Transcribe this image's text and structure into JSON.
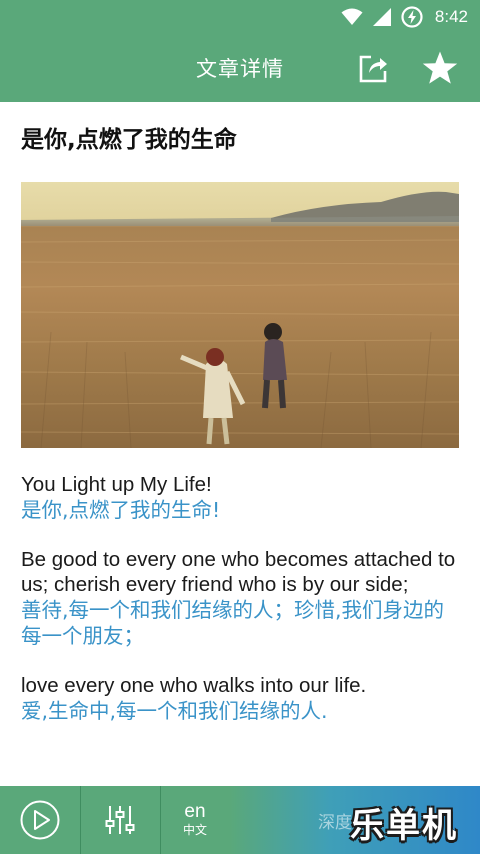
{
  "status_bar": {
    "time": "8:42",
    "icons": [
      "wifi-icon",
      "signal-icon",
      "battery-charging-icon"
    ]
  },
  "app_bar": {
    "title": "文章详情",
    "actions": [
      "share-icon",
      "star-icon"
    ]
  },
  "article": {
    "title": "是你,点燃了我的生命",
    "image": "two people walking in a wheat field",
    "paragraphs": [
      {
        "en": "You Light up My Life!",
        "zh": "是你,点燃了我的生命!"
      },
      {
        "en": "Be good to every one who becomes attached to us; cherish every friend who is by our side;",
        "zh": "善待,每一个和我们结缘的人；珍惜,我们身边的每一个朋友；"
      },
      {
        "en": "love every one who walks into our life.",
        "zh": "爱,生命中,每一个和我们结缘的人."
      }
    ]
  },
  "bottom_bar": {
    "play_icon": "play-icon",
    "equalizer_icon": "equalizer-icon",
    "lang_en": "en",
    "lang_zh": "中文",
    "track_label": "深度"
  },
  "watermark": "乐单机",
  "colors": {
    "primary": "#5aa87a",
    "chinese_text": "#3a93c8",
    "english_text": "#1b1b1b"
  }
}
